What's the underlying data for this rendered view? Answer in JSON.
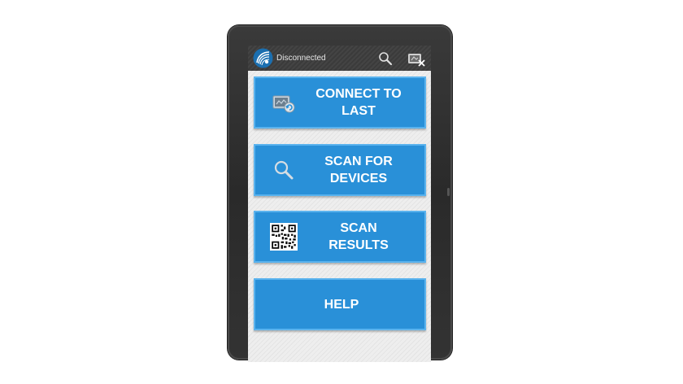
{
  "app": {
    "status": "Disconnected"
  },
  "action_bar": {
    "logo_icon": "app-logo-icon",
    "search_icon": "search-icon",
    "disconnect_icon": "disconnect-icon"
  },
  "buttons": [
    {
      "label": "CONNECT TO\nLAST",
      "icon": "reconnect-icon"
    },
    {
      "label": "SCAN FOR\nDEVICES",
      "icon": "search-icon"
    },
    {
      "label": "SCAN\nRESULTS",
      "icon": "qr-code-icon"
    },
    {
      "label": "HELP",
      "icon": ""
    }
  ],
  "colors": {
    "button_fill": "#2990d8",
    "button_border": "#5ab3ee",
    "action_bar": "#3b3b3b",
    "device_frame": "#2f2f2f"
  }
}
